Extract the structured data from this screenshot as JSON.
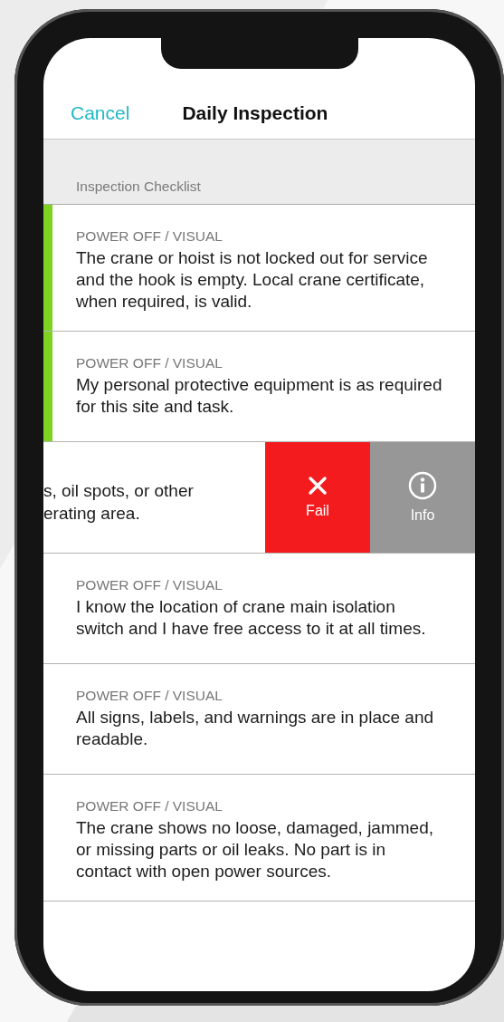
{
  "nav": {
    "cancel": "Cancel",
    "title": "Daily Inspection"
  },
  "section": {
    "header": "Inspection Checklist"
  },
  "items": [
    {
      "kind": "row",
      "category": "POWER OFF / VISUAL",
      "text": "The crane or hoist is not locked out for service and the hook is empty. Local crane certificate, when required, is valid.",
      "passed": true
    },
    {
      "kind": "row",
      "category": "POWER OFF / VISUAL",
      "text": "My personal protective equipment is as required for this site and task.",
      "passed": true
    },
    {
      "kind": "swiped",
      "text": "s, oil spots, or other\nerating area.",
      "actions": [
        {
          "kind": "fail",
          "label": "Fail"
        },
        {
          "kind": "info",
          "label": "Info"
        }
      ]
    },
    {
      "kind": "row",
      "category": "POWER OFF / VISUAL",
      "text": "I know the location of crane main isolation switch and I have free access to it at all times.",
      "passed": false
    },
    {
      "kind": "row",
      "category": "POWER OFF / VISUAL",
      "text": "All signs, labels, and warnings are in place and readable.",
      "passed": false
    },
    {
      "kind": "row",
      "category": "POWER OFF / VISUAL",
      "text": "The crane shows no loose, damaged, jammed, or missing parts or oil leaks. No part is in contact with open power sources.",
      "passed": false
    }
  ]
}
